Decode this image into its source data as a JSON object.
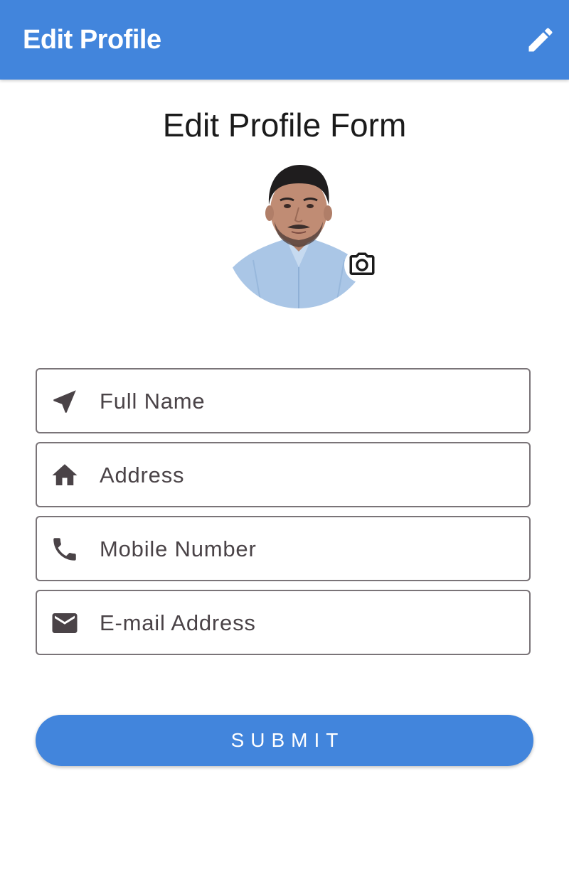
{
  "app_bar": {
    "title": "Edit Profile",
    "action_icon": "edit-pencil-icon",
    "background": "#4285dc"
  },
  "form": {
    "heading": "Edit Profile Form",
    "avatar": {
      "alt": "Profile photo",
      "camera_icon": "camera-icon"
    },
    "fields": [
      {
        "label": "Full Name",
        "value": "",
        "icon": "navigation-arrow-icon"
      },
      {
        "label": "Address",
        "value": "",
        "icon": "home-icon"
      },
      {
        "label": "Mobile Number",
        "value": "",
        "icon": "phone-icon"
      },
      {
        "label": "E-mail Address",
        "value": "",
        "icon": "email-icon"
      }
    ],
    "submit_label": "SUBMIT",
    "colors": {
      "accent": "#4285dc",
      "field_border": "#7a7478",
      "field_text": "#4a4347"
    }
  }
}
